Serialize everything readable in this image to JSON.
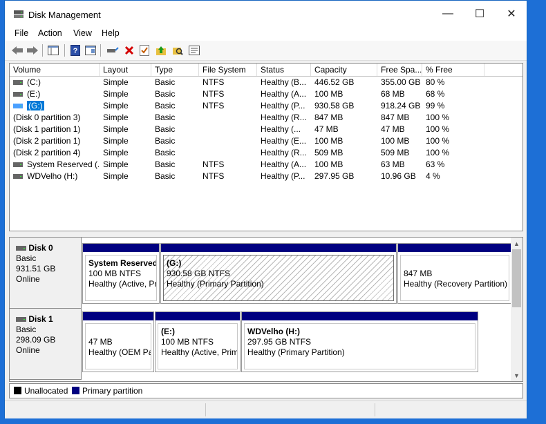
{
  "window": {
    "title": "Disk Management",
    "minimize_glyph": "—",
    "maximize_glyph": "☐",
    "close_glyph": "✕"
  },
  "menu": [
    "File",
    "Action",
    "View",
    "Help"
  ],
  "toolbar_icons": [
    "back-arrow-icon",
    "forward-arrow-icon",
    "console-tree-icon",
    "help-icon",
    "console-tree-icon-2",
    "connect-drive-icon",
    "delete-icon",
    "check-icon",
    "up-arrow-icon",
    "search-folder-icon",
    "properties-icon"
  ],
  "volume_list": {
    "columns": [
      "Volume",
      "Layout",
      "Type",
      "File System",
      "Status",
      "Capacity",
      "Free Spa...",
      "% Free"
    ],
    "rows": [
      {
        "volume": "(C:)",
        "layout": "Simple",
        "type": "Basic",
        "fs": "NTFS",
        "status": "Healthy (B...",
        "capacity": "446.52 GB",
        "free": "355.00 GB",
        "pct": "80 %",
        "icon": "drive"
      },
      {
        "volume": "(E:)",
        "layout": "Simple",
        "type": "Basic",
        "fs": "NTFS",
        "status": "Healthy (A...",
        "capacity": "100 MB",
        "free": "68 MB",
        "pct": "68 %",
        "icon": "drive"
      },
      {
        "volume": "(G:)",
        "layout": "Simple",
        "type": "Basic",
        "fs": "NTFS",
        "status": "Healthy (P...",
        "capacity": "930.58 GB",
        "free": "918.24 GB",
        "pct": "99 %",
        "icon": "drive",
        "selected": true
      },
      {
        "volume": "(Disk 0 partition 3)",
        "layout": "Simple",
        "type": "Basic",
        "fs": "",
        "status": "Healthy (R...",
        "capacity": "847 MB",
        "free": "847 MB",
        "pct": "100 %",
        "icon": "none"
      },
      {
        "volume": "(Disk 1 partition 1)",
        "layout": "Simple",
        "type": "Basic",
        "fs": "",
        "status": "Healthy (...",
        "capacity": "47 MB",
        "free": "47 MB",
        "pct": "100 %",
        "icon": "none"
      },
      {
        "volume": "(Disk 2 partition 1)",
        "layout": "Simple",
        "type": "Basic",
        "fs": "",
        "status": "Healthy (E...",
        "capacity": "100 MB",
        "free": "100 MB",
        "pct": "100 %",
        "icon": "none"
      },
      {
        "volume": "(Disk 2 partition 4)",
        "layout": "Simple",
        "type": "Basic",
        "fs": "",
        "status": "Healthy (R...",
        "capacity": "509 MB",
        "free": "509 MB",
        "pct": "100 %",
        "icon": "none"
      },
      {
        "volume": "System Reserved (...",
        "layout": "Simple",
        "type": "Basic",
        "fs": "NTFS",
        "status": "Healthy (A...",
        "capacity": "100 MB",
        "free": "63 MB",
        "pct": "63 %",
        "icon": "drive"
      },
      {
        "volume": "WDVelho (H:)",
        "layout": "Simple",
        "type": "Basic",
        "fs": "NTFS",
        "status": "Healthy (P...",
        "capacity": "297.95 GB",
        "free": "10.96 GB",
        "pct": "4 %",
        "icon": "drive"
      }
    ]
  },
  "disks": [
    {
      "name": "Disk 0",
      "type": "Basic",
      "size": "931.51 GB",
      "state": "Online",
      "partitions": [
        {
          "name": "System Reserved",
          "size": "100 MB NTFS",
          "status": "Healthy (Active, Pr"
        },
        {
          "name": "(G:)",
          "size": "930.58 GB NTFS",
          "status": "Healthy (Primary Partition)"
        },
        {
          "name": "",
          "size": "847 MB",
          "status": "Healthy (Recovery Partition)"
        }
      ]
    },
    {
      "name": "Disk 1",
      "type": "Basic",
      "size": "298.09 GB",
      "state": "Online",
      "partitions": [
        {
          "name": "",
          "size": "47 MB",
          "status": "Healthy (OEM Pa"
        },
        {
          "name": "(E:)",
          "size": "100 MB NTFS",
          "status": "Healthy (Active, Prim"
        },
        {
          "name": "WDVelho  (H:)",
          "size": "297.95 GB NTFS",
          "status": "Healthy (Primary Partition)"
        }
      ]
    }
  ],
  "legend": [
    {
      "label": "Unallocated",
      "color": "#000000"
    },
    {
      "label": "Primary partition",
      "color": "#000080"
    }
  ],
  "colors": {
    "accent": "#0078d7",
    "primary_partition": "#000080",
    "window_border": "#1565c0"
  }
}
